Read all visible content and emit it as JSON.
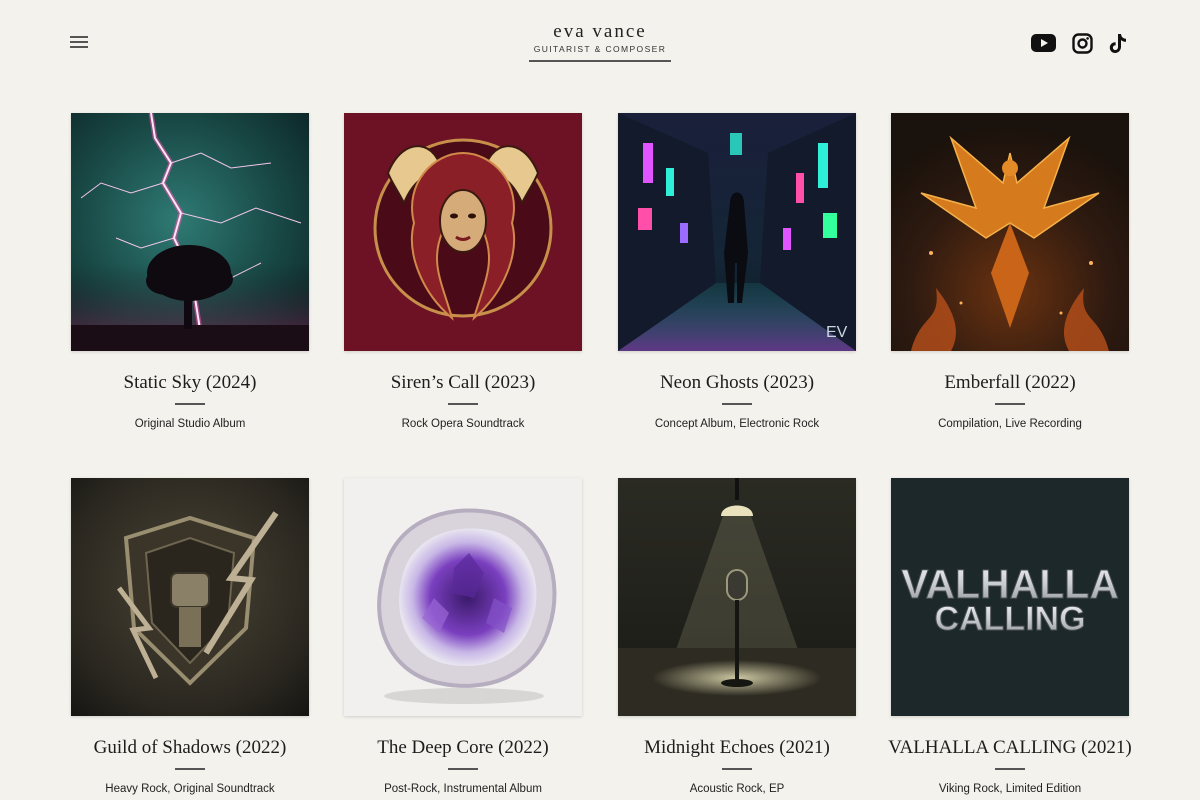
{
  "header": {
    "brand_name": "eva vance",
    "brand_subtitle": "GUITARIST & COMPOSER"
  },
  "icons": {
    "menu": "hamburger-menu-icon",
    "youtube": "youtube-icon",
    "instagram": "instagram-icon",
    "tiktok": "tiktok-icon"
  },
  "albums": [
    {
      "title": "Static Sky (2024)",
      "description": "Original Studio Album"
    },
    {
      "title": "Siren’s Call (2023)",
      "description": "Rock Opera Soundtrack"
    },
    {
      "title": "Neon Ghosts (2023)",
      "description": "Concept Album, Electronic Rock",
      "cover_mark": "EV"
    },
    {
      "title": "Emberfall (2022)",
      "description": "Compilation, Live Recording"
    },
    {
      "title": "Guild of Shadows (2022)",
      "description": "Heavy Rock, Original Soundtrack"
    },
    {
      "title": "The Deep Core (2022)",
      "description": "Post-Rock, Instrumental Album"
    },
    {
      "title": "Midnight Echoes (2021)",
      "description": "Acoustic Rock, EP"
    },
    {
      "title": "VALHALLA CALLING (2021)",
      "description": "Viking Rock, Limited Edition",
      "cover_text": [
        "VALHALLA",
        "CALLING"
      ]
    }
  ],
  "colors": {
    "background": "#f4f2ec",
    "text": "#1e1e1e"
  }
}
